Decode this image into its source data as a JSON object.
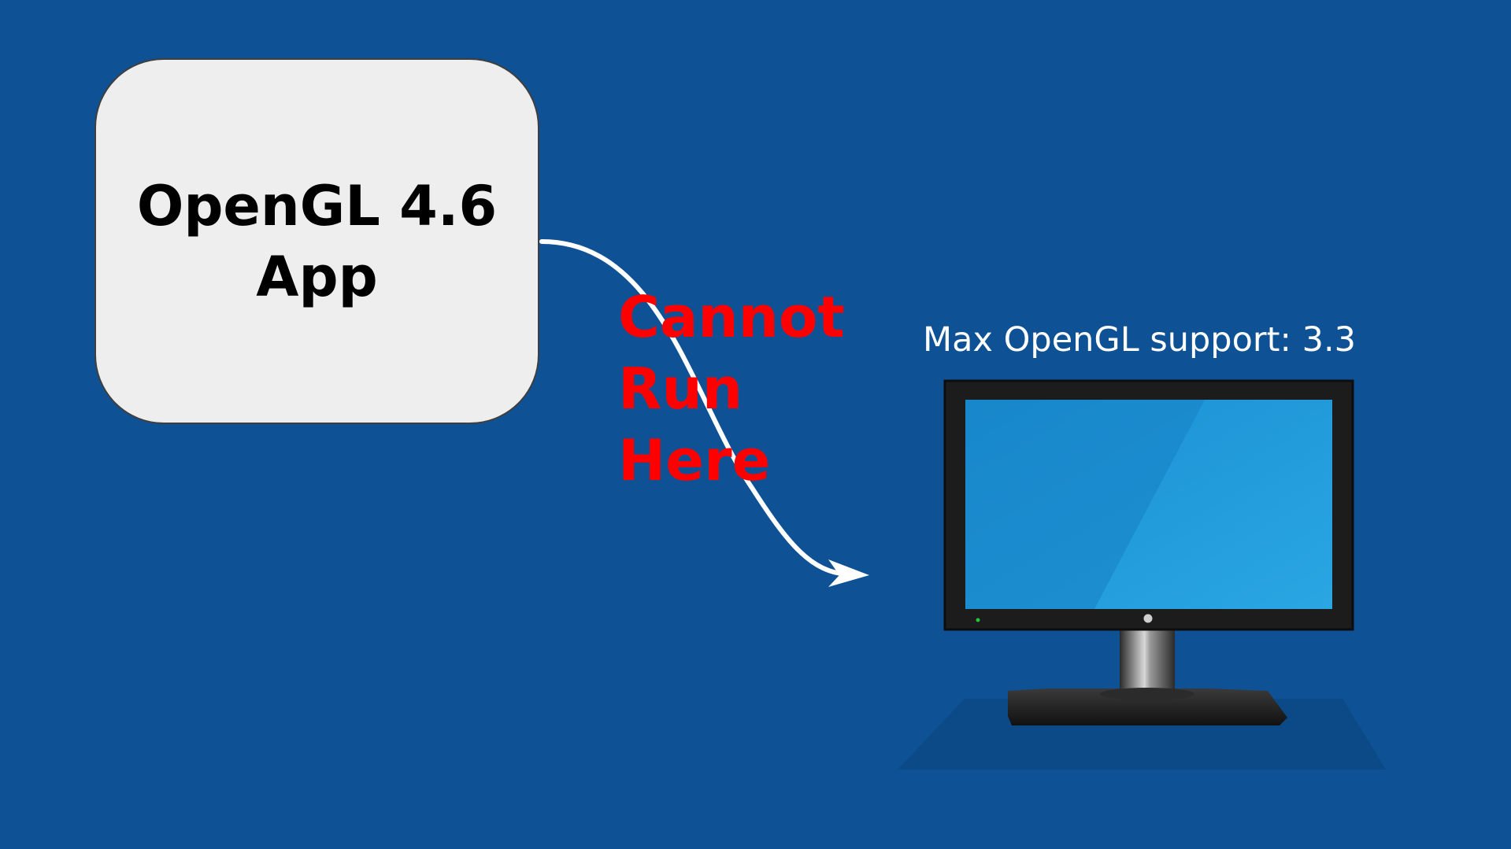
{
  "app_box": {
    "lines": [
      "OpenGL 4.6",
      "App"
    ]
  },
  "warning": {
    "lines": [
      "Cannot",
      "Run",
      "Here"
    ],
    "color": "#ff0000"
  },
  "monitor": {
    "label": "Max OpenGL support: 3.3",
    "icon": "monitor-icon"
  },
  "colors": {
    "background": "#0e5195",
    "box_fill": "#eeeeee",
    "arrow": "#ffffff",
    "screen": "#239bd9"
  }
}
